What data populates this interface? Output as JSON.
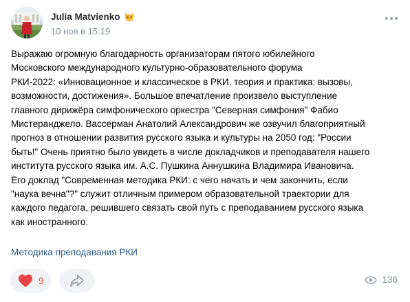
{
  "post": {
    "author": "Julia Matvienko",
    "author_badge_icon": "cat-face-icon",
    "timestamp": "10 ноя в 15:19",
    "text_lines": [
      "Выражаю огромную благодарность организаторам пятого юбилейного",
      "Московского международного культурно-образовательного форума",
      "РКИ-2022: «Инновационное и классическое в РКИ. теория и практика: вызовы,",
      "возможности, достижения». Большое впечатление произвело выступление",
      "главного дирижёра симфонического оркестра \"Северная симфония\" Фабио",
      "Мистеранджело. Вассерман Анатолий Александрович же озвучил благоприятный",
      "прогноз в отношении развития русского языка и культуры на 2050 год: \"России",
      "быть!\" Очень приятно было увидеть в числе докладчиков и преподавателя нашего",
      "института русского языка им. А.С. Пушкина Аннушкина Владимира Ивановича.",
      "Его доклад \"Современная методика РКИ: с чего начать и чем закончить, если",
      "\"наука вечна\"?\" служит отличным примером образовательной траектории для",
      "каждого педагога, решившего связать свой путь с преподаванием русского языка",
      "как иностранного."
    ],
    "hashtag": "Методика преподавания РКИ",
    "likes": "9",
    "views": "136"
  },
  "icons": {
    "more": "more-horizontal-icon",
    "like": "heart-icon",
    "share": "share-arrow-icon",
    "views": "eye-icon"
  },
  "colors": {
    "like_active": "#e64646",
    "link": "#2a5885",
    "secondary_text": "#818c99",
    "button_bg": "#f0f2f5"
  }
}
